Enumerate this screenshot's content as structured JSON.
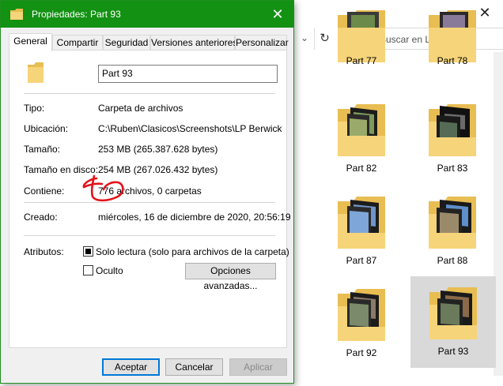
{
  "dialog": {
    "title": "Propiedades: Part 93",
    "close_glyph": "✕",
    "tabs": [
      {
        "label": "General"
      },
      {
        "label": "Compartir"
      },
      {
        "label": "Seguridad"
      },
      {
        "label": "Versiones anteriores"
      },
      {
        "label": "Personalizar"
      }
    ],
    "name_value": "Part 93",
    "props": [
      {
        "label": "Tipo:",
        "value": "Carpeta de archivos"
      },
      {
        "label": "Ubicación:",
        "value": "C:\\Ruben\\Clasicos\\Screenshots\\LP Berwick"
      },
      {
        "label": "Tamaño:",
        "value": "253 MB (265.387.628 bytes)"
      },
      {
        "label": "Tamaño en disco:",
        "value": "254 MB (267.026.432 bytes)"
      },
      {
        "label": "Contiene:",
        "value": "776 archivos, 0 carpetas"
      },
      {
        "label": "Creado:",
        "value": "miércoles, 16 de diciembre de 2020, 20:56:19"
      }
    ],
    "attributes_label": "Atributos:",
    "readonly_label": "Solo lectura (solo para archivos de la carpeta)",
    "hidden_label": "Oculto",
    "advanced_label": "Opciones avanzadas...",
    "ok_label": "Aceptar",
    "cancel_label": "Cancelar",
    "apply_label": "Aplicar"
  },
  "explorer": {
    "close_glyph": "✕",
    "search_placeholder": "Buscar en LP Berwick",
    "refresh_glyph": "↻",
    "chevron_glyph": "⌄",
    "folders": [
      {
        "label": "Part 77"
      },
      {
        "label": "Part 78"
      },
      {
        "label": "Part 82"
      },
      {
        "label": "Part 83"
      },
      {
        "label": "Part 87"
      },
      {
        "label": "Part 88"
      },
      {
        "label": "Part 92"
      },
      {
        "label": "Part 93"
      }
    ]
  },
  "colors": {
    "title_bar": "#139113",
    "folder_yellow": "#f6d479",
    "annotation_red": "#e3121a",
    "selected_tile": "#d9d9d9"
  }
}
